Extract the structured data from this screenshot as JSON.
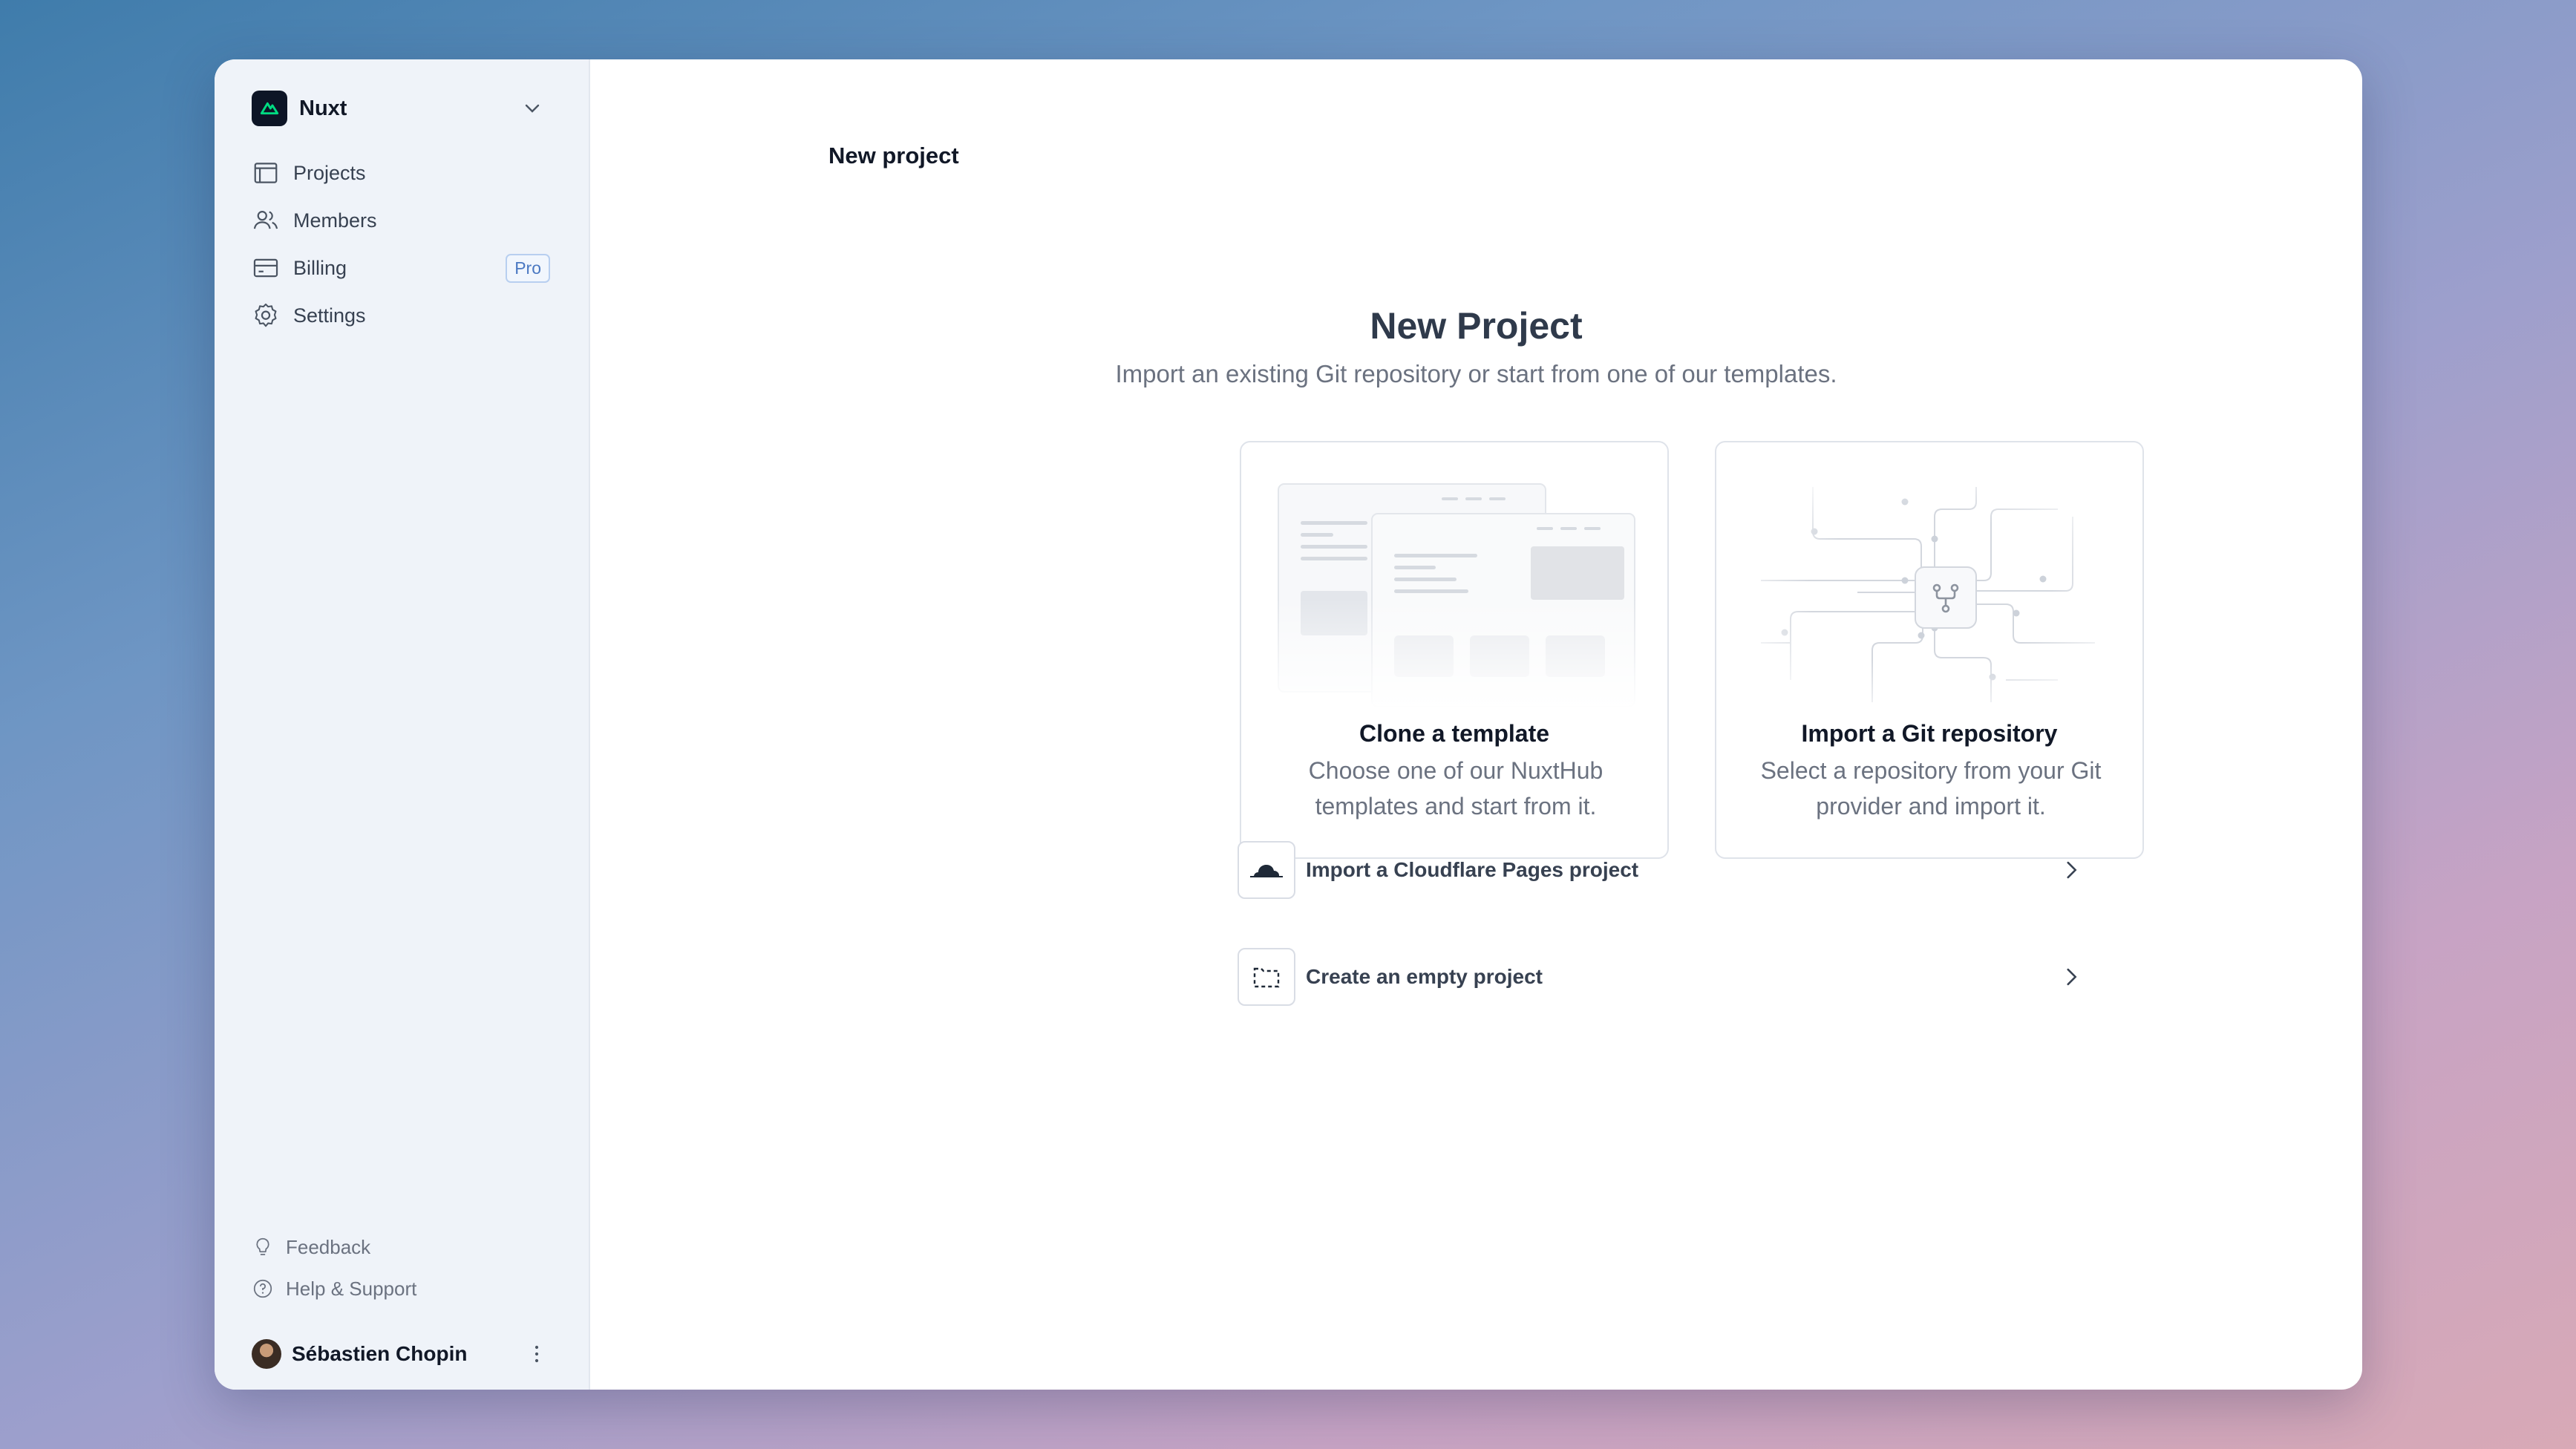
{
  "team": {
    "name": "Nuxt",
    "logo_icon": "nuxt-logo-icon"
  },
  "sidebar": {
    "items": [
      {
        "label": "Projects",
        "icon": "projects-icon"
      },
      {
        "label": "Members",
        "icon": "members-icon"
      },
      {
        "label": "Billing",
        "icon": "billing-icon",
        "badge": "Pro"
      },
      {
        "label": "Settings",
        "icon": "settings-icon"
      }
    ],
    "bottom": [
      {
        "label": "Feedback",
        "icon": "lightbulb-icon"
      },
      {
        "label": "Help & Support",
        "icon": "help-icon"
      }
    ],
    "user": {
      "name": "Sébastien Chopin"
    }
  },
  "header": {
    "title": "New project"
  },
  "main": {
    "heading": "New Project",
    "subheading": "Import an existing Git repository or start from one of our templates.",
    "cards": [
      {
        "title": "Clone a template",
        "description": "Choose one of our NuxtHub templates and start from it."
      },
      {
        "title": "Import a Git repository",
        "description": "Select a repository from your Git provider and import it."
      }
    ],
    "actions": [
      {
        "label": "Import a Cloudflare Pages project",
        "icon": "cloudflare-icon"
      },
      {
        "label": "Create an empty project",
        "icon": "empty-project-icon"
      }
    ]
  },
  "colors": {
    "accent": "#00dc82",
    "badge": "#4a78c2",
    "sidebar_bg": "#eff3f9"
  }
}
